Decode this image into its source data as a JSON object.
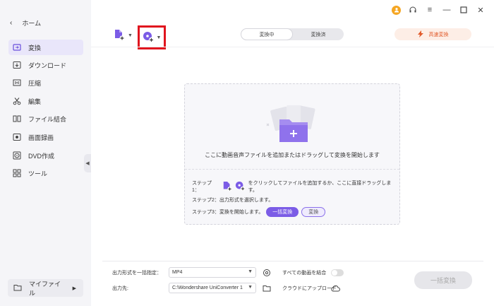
{
  "sidebar": {
    "home": "ホーム",
    "items": [
      {
        "label": "変換",
        "icon": "convert-icon"
      },
      {
        "label": "ダウンロード",
        "icon": "download-icon"
      },
      {
        "label": "圧縮",
        "icon": "compress-icon"
      },
      {
        "label": "編集",
        "icon": "scissors-icon"
      },
      {
        "label": "ファイル結合",
        "icon": "merge-icon"
      },
      {
        "label": "画面録画",
        "icon": "screen-record-icon"
      },
      {
        "label": "DVD作成",
        "icon": "dvd-icon"
      },
      {
        "label": "ツール",
        "icon": "tools-icon"
      }
    ],
    "my_files": "マイファイル"
  },
  "toolbar": {
    "tab_converting": "変換中",
    "tab_converted": "変換済",
    "fast_convert": "高速変換"
  },
  "drop": {
    "main_text": "ここに動画音声ファイルを追加またはドラッグして変換を開始します",
    "step1_prefix": "ステップ1：",
    "step1_suffix": "をクリックしてファイルを追加するか、ここに直接ドラッグします。",
    "step2": "ステップ2：出力形式を選択します。",
    "step3": "ステップ3：変換を開始します。",
    "btn_convert_all": "一括変換",
    "btn_convert": "変換"
  },
  "footer": {
    "format_label": "出力形式を一括指定：",
    "format_value": "MP4",
    "dest_label": "出力先:",
    "dest_value": "C:\\Wondershare UniConverter 1",
    "merge_label": "すべての動画を結合",
    "cloud_label": "クラウドにアップロード",
    "convert_all": "一括変換"
  },
  "colors": {
    "accent": "#7b5ce6",
    "highlight_box": "#e0141e",
    "fast_convert": "#e15a2a"
  }
}
